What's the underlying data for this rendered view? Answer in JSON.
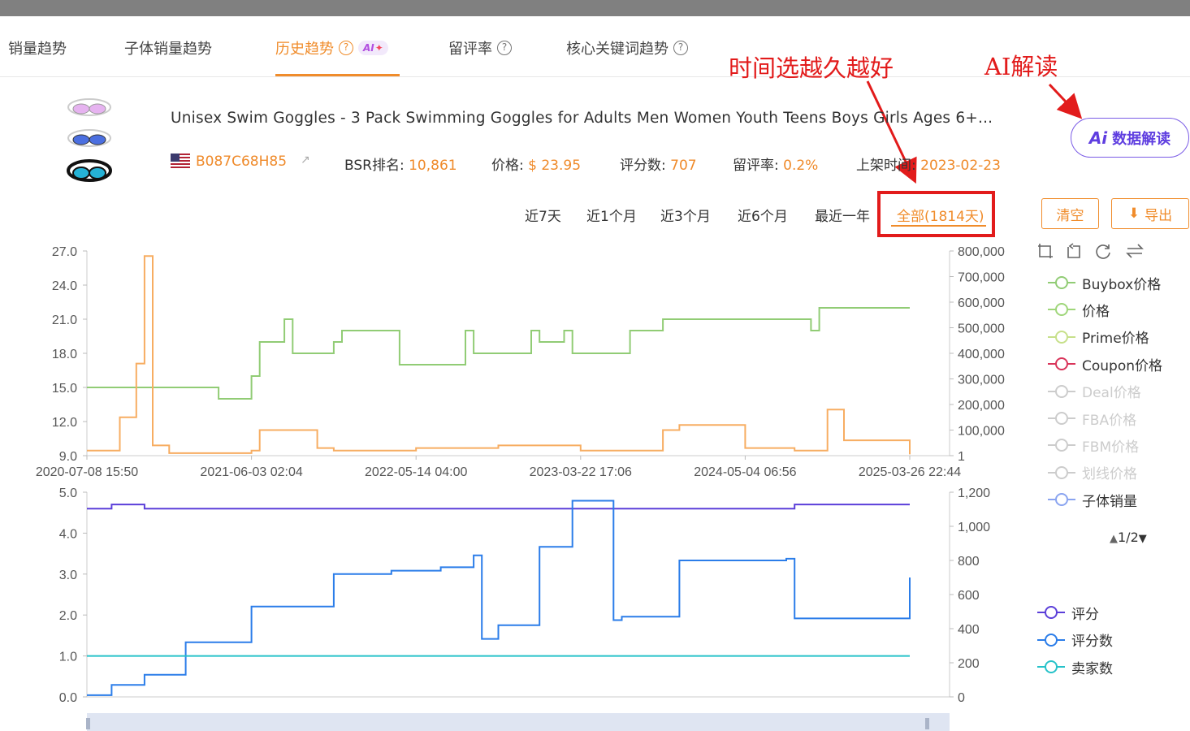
{
  "tabs": [
    {
      "label": "销量趋势"
    },
    {
      "label": "子体销量趋势"
    },
    {
      "label": "历史趋势",
      "help": "?",
      "badge": "AI"
    },
    {
      "label": "留评率",
      "help": "?"
    },
    {
      "label": "核心关键词趋势",
      "help": "?"
    }
  ],
  "annotations": {
    "time_hint": "时间选越久越好",
    "ai_hint": "AI解读"
  },
  "product": {
    "title": "Unisex Swim Goggles - 3 Pack Swimming Goggles for Adults Men Women Youth Teens Boys Girls Ages 6+...",
    "asin": "B087C68H85",
    "bsr_label": "BSR排名:",
    "bsr_value": "10,861",
    "price_label": "价格:",
    "price_value": "$ 23.95",
    "rating_count_label": "评分数:",
    "rating_count_value": "707",
    "review_rate_label": "留评率:",
    "review_rate_value": "0.2%",
    "listed_label": "上架时间:",
    "listed_value": "2023-02-23"
  },
  "ai_button": {
    "icon": "Ai",
    "label": "数据解读"
  },
  "ranges": [
    "近7天",
    "近1个月",
    "近3个月",
    "近6个月",
    "最近一年",
    "全部(1814天)"
  ],
  "active_range": "全部(1814天)",
  "buttons": {
    "clear": "清空",
    "export": "导出"
  },
  "toolbox_icons": [
    "zoom-select-icon",
    "zoom-reset-icon",
    "restore-icon",
    "switch-icon"
  ],
  "legend_top": [
    {
      "name": "Buybox价格",
      "color": "#91cc75",
      "enabled": true
    },
    {
      "name": "价格",
      "color": "#9fd67a",
      "enabled": true
    },
    {
      "name": "Prime价格",
      "color": "#c7e08a",
      "enabled": true
    },
    {
      "name": "Coupon价格",
      "color": "#d9345a",
      "enabled": true
    },
    {
      "name": "Deal价格",
      "color": "#cccccc",
      "enabled": false
    },
    {
      "name": "FBA价格",
      "color": "#cccccc",
      "enabled": false
    },
    {
      "name": "FBM价格",
      "color": "#cccccc",
      "enabled": false
    },
    {
      "name": "划线价格",
      "color": "#cccccc",
      "enabled": false
    },
    {
      "name": "子体销量",
      "color": "#8aa4f0",
      "enabled": true
    }
  ],
  "pager": "1/2",
  "legend_bottom": [
    {
      "name": "评分",
      "color": "#5b3fd9"
    },
    {
      "name": "评分数",
      "color": "#2b7de9"
    },
    {
      "name": "卖家数",
      "color": "#26c2c9"
    }
  ],
  "chart_data": [
    {
      "type": "line",
      "x_ticks": [
        "2020-07-08 15:50",
        "2021-06-03 02:04",
        "2022-05-14 04:00",
        "2023-03-22 17:06",
        "2024-05-04 06:56",
        "2025-03-26 22:44"
      ],
      "y_left_ticks": [
        "27.0",
        "24.0",
        "21.0",
        "18.0",
        "15.0",
        "12.0",
        "9.0"
      ],
      "y_left_lim": [
        9,
        27
      ],
      "y_right_ticks": [
        "800,000",
        "700,000",
        "600,000",
        "500,000",
        "400,000",
        "300,000",
        "200,000",
        "100,000",
        "1"
      ],
      "y_right_lim": [
        1,
        800000
      ],
      "series": [
        {
          "name": "Buybox价格",
          "color": "#91cc75",
          "axis": "left",
          "x": [
            0,
            0.03,
            0.155,
            0.16,
            0.2,
            0.21,
            0.24,
            0.25,
            0.3,
            0.31,
            0.37,
            0.38,
            0.46,
            0.47,
            0.54,
            0.55,
            0.58,
            0.59,
            0.66,
            0.67,
            0.7,
            0.71,
            0.88,
            0.89,
            1.0
          ],
          "y": [
            15.0,
            15.0,
            15.0,
            14.0,
            16.0,
            19.0,
            21.0,
            18.0,
            19.0,
            20.0,
            20.0,
            17.0,
            20.0,
            18.0,
            20.0,
            19.0,
            20.0,
            18.0,
            20.0,
            20.0,
            21.0,
            21.0,
            20.0,
            22.0,
            22.0
          ]
        },
        {
          "name": "子体销量",
          "color": "#f7ad62",
          "axis": "right",
          "x": [
            0,
            0.04,
            0.06,
            0.07,
            0.08,
            0.1,
            0.2,
            0.21,
            0.28,
            0.3,
            0.4,
            0.5,
            0.6,
            0.7,
            0.72,
            0.8,
            0.86,
            0.9,
            0.92,
            1.0
          ],
          "y": [
            20000,
            150000,
            360000,
            780000,
            40000,
            10000,
            20000,
            100000,
            30000,
            20000,
            30000,
            40000,
            20000,
            100000,
            120000,
            30000,
            20000,
            180000,
            60000,
            5000
          ]
        }
      ]
    },
    {
      "type": "line",
      "y_left_ticks": [
        "5.0",
        "4.0",
        "3.0",
        "2.0",
        "1.0",
        "0.0"
      ],
      "y_left_lim": [
        0,
        5
      ],
      "y_right_ticks": [
        "1,200",
        "1,000",
        "800",
        "600",
        "400",
        "200",
        "0"
      ],
      "y_right_lim": [
        0,
        1200
      ],
      "series": [
        {
          "name": "评分",
          "color": "#5b3fd9",
          "axis": "left",
          "x": [
            0,
            0.03,
            0.07,
            0.47,
            0.49,
            0.85,
            0.86,
            1.0
          ],
          "y": [
            4.6,
            4.7,
            4.6,
            4.6,
            4.6,
            4.6,
            4.7,
            4.7
          ]
        },
        {
          "name": "评分数",
          "color": "#2b7de9",
          "axis": "right",
          "x": [
            0,
            0.03,
            0.07,
            0.12,
            0.2,
            0.3,
            0.37,
            0.43,
            0.47,
            0.48,
            0.5,
            0.55,
            0.59,
            0.64,
            0.65,
            0.72,
            0.85,
            0.86,
            1.0
          ],
          "y": [
            10,
            70,
            130,
            320,
            530,
            720,
            740,
            760,
            830,
            340,
            420,
            880,
            1150,
            450,
            470,
            800,
            810,
            460,
            700
          ]
        },
        {
          "name": "卖家数",
          "color": "#26c2c9",
          "axis": "left",
          "x": [
            0,
            1.0
          ],
          "y": [
            1.0,
            1.0
          ]
        }
      ]
    }
  ]
}
